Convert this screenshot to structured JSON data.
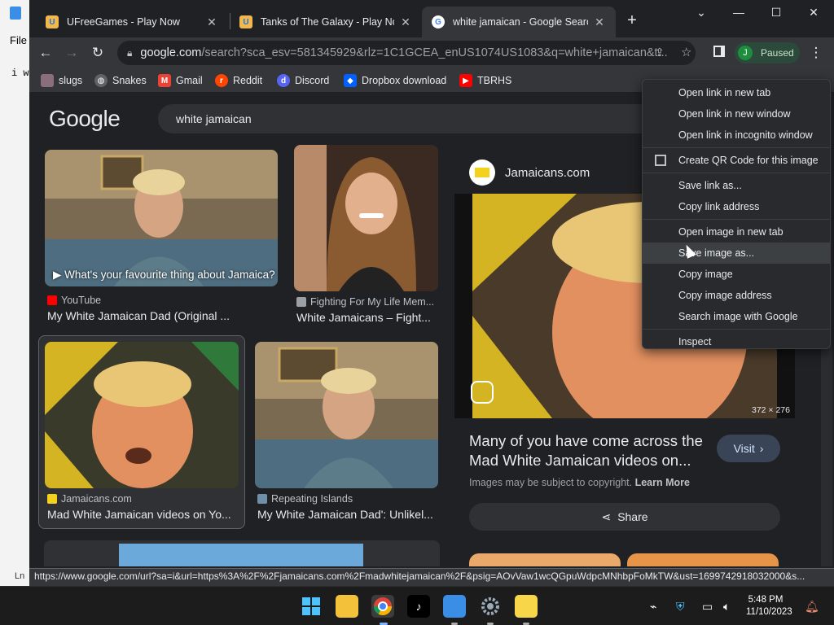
{
  "notepad": {
    "menu_file": "File",
    "text_line": "i w",
    "status": "Ln"
  },
  "tabs": [
    {
      "title": "UFreeGames - Play Now",
      "close": "✕"
    },
    {
      "title": "Tanks of The Galaxy - Play Now",
      "close": "✕"
    },
    {
      "title": "white jamaican - Google Search",
      "close": "✕"
    }
  ],
  "new_tab": "+",
  "window_controls": {
    "dropdown": "⌄",
    "minimize": "—",
    "maximize": "☐",
    "close": "✕"
  },
  "toolbar": {
    "back": "←",
    "forward": "→",
    "reload": "↻",
    "url_host": "google.com",
    "url_path": "/search?sca_esv=581345929&rlz=1C1GCEA_enUS1074US1083&q=white+jamaican&t...",
    "profile_initial": "J",
    "profile_status": "Paused",
    "menu": "⋮"
  },
  "bookmarks": [
    {
      "label": "slugs",
      "color": "#8a6e7e"
    },
    {
      "label": "Snakes",
      "color": "#5f6368"
    },
    {
      "label": "Gmail",
      "color": "#ea4335"
    },
    {
      "label": "Reddit",
      "color": "#ff4500"
    },
    {
      "label": "Discord",
      "color": "#5865f2"
    },
    {
      "label": "Dropbox download",
      "color": "#0061ff"
    },
    {
      "label": "TBRHS",
      "color": "#ff0000"
    }
  ],
  "google": {
    "logo": "Google",
    "query": "white jamaican"
  },
  "results": [
    {
      "source": "YouTube",
      "title": "My White Jamaican Dad (Original ...",
      "overlay": "▶ What's your favourite thing about Jamaica?"
    },
    {
      "source": "Fighting For My Life Mem...",
      "title": "White Jamaicans – Fight..."
    },
    {
      "source": "Jamaicans.com",
      "title": "Mad White Jamaican videos on Yo..."
    },
    {
      "source": "Repeating Islands",
      "title": "My White Jamaican Dad': Unlikel..."
    }
  ],
  "side_panel": {
    "site": "Jamaicans.com",
    "image_size": "372 × 276",
    "title": "Many of you have come across the Mad White Jamaican videos on...",
    "visit": "Visit",
    "copyright": "Images may be subject to copyright.",
    "learn_more": "Learn More",
    "share": "Share"
  },
  "context_menu": {
    "open_new_tab": "Open link in new tab",
    "open_new_window": "Open link in new window",
    "open_incognito": "Open link in incognito window",
    "qr_code": "Create QR Code for this image",
    "save_link": "Save link as...",
    "copy_link": "Copy link address",
    "open_image": "Open image in new tab",
    "save_image": "Save image as...",
    "copy_image": "Copy image",
    "copy_image_address": "Copy image address",
    "search_image": "Search image with Google",
    "inspect": "Inspect"
  },
  "status_url": "https://www.google.com/url?sa=i&url=https%3A%2F%2Fjamaicans.com%2Fmadwhitejamaican%2F&psig=AOvVaw1wcQGpuWdpcMNhbpFoMkTW&ust=1699742918032000&s...",
  "taskbar": {
    "time": "5:48 PM",
    "date": "11/10/2023"
  }
}
